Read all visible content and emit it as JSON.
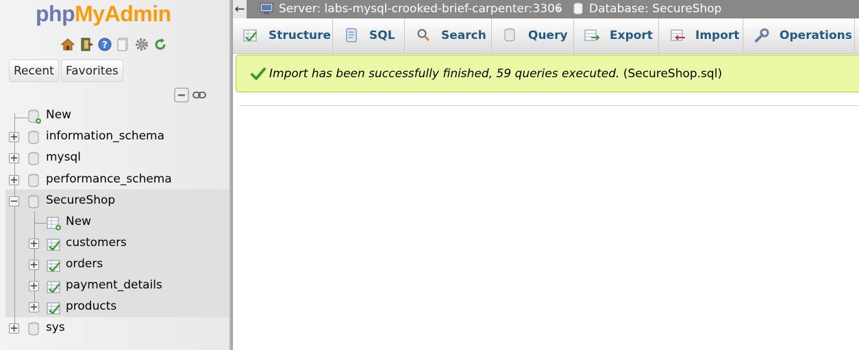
{
  "logo": {
    "php": "php",
    "my": "My",
    "admin": "Admin"
  },
  "nav_buttons": {
    "recent": "Recent",
    "favorites": "Favorites"
  },
  "nav_icons": [
    "home-icon",
    "logout-icon",
    "help-icon",
    "docs-icon",
    "settings-icon",
    "reload-icon"
  ],
  "tree": {
    "new_db": "New",
    "databases": [
      {
        "name": "information_schema"
      },
      {
        "name": "mysql"
      },
      {
        "name": "performance_schema"
      },
      {
        "name": "SecureShop"
      },
      {
        "name": "sys"
      }
    ],
    "secureshop_children": {
      "new_table": "New",
      "tables": [
        "customers",
        "orders",
        "payment_details",
        "products"
      ]
    }
  },
  "topbar": {
    "back": "←",
    "server": "Server: labs-mysql-crooked-brief-carpenter:3306",
    "separator": "»",
    "database": "Database: SecureShop"
  },
  "tabs": [
    {
      "label": "Structure",
      "icon": "structure-icon"
    },
    {
      "label": "SQL",
      "icon": "sql-icon"
    },
    {
      "label": "Search",
      "icon": "search-icon"
    },
    {
      "label": "Query",
      "icon": "query-icon"
    },
    {
      "label": "Export",
      "icon": "export-icon"
    },
    {
      "label": "Import",
      "icon": "import-icon"
    },
    {
      "label": "Operations",
      "icon": "operations-icon"
    }
  ],
  "message": {
    "text": "Import has been successfully finished, 59 queries executed.",
    "file": "(SecureShop.sql)"
  },
  "colors": {
    "success_bg": "#ebf8a4",
    "success_border": "#a2d246",
    "tab_text": "#235a81",
    "topbar_bg": "#888888"
  }
}
